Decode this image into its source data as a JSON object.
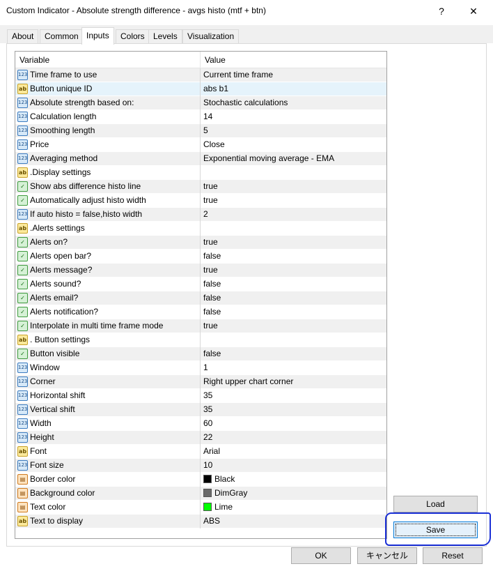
{
  "window": {
    "title": "Custom Indicator - Absolute strength difference - avgs histo (mtf + btn)",
    "help_label": "?",
    "close_label": "✕"
  },
  "tabs": [
    {
      "label": "About"
    },
    {
      "label": "Common"
    },
    {
      "label": "Inputs"
    },
    {
      "label": "Colors"
    },
    {
      "label": "Levels"
    },
    {
      "label": "Visualization"
    }
  ],
  "active_tab": "Inputs",
  "grid": {
    "headers": {
      "variable": "Variable",
      "value": "Value"
    },
    "rows": [
      {
        "icon": "number-type-icon",
        "type": "num",
        "name": "Time frame to use",
        "value": "Current time frame"
      },
      {
        "icon": "string-type-icon",
        "type": "str",
        "name": "Button unique ID",
        "value": "abs b1"
      },
      {
        "icon": "number-type-icon",
        "type": "num",
        "name": "Absolute strength based on:",
        "value": "Stochastic calculations"
      },
      {
        "icon": "number-type-icon",
        "type": "num",
        "name": "Calculation length",
        "value": "14"
      },
      {
        "icon": "number-type-icon",
        "type": "num",
        "name": "Smoothing length",
        "value": "5"
      },
      {
        "icon": "number-type-icon",
        "type": "num",
        "name": "Price",
        "value": "Close"
      },
      {
        "icon": "number-type-icon",
        "type": "num",
        "name": "Averaging method",
        "value": "Exponential moving average - EMA"
      },
      {
        "icon": "string-type-icon",
        "type": "str",
        "name": ".Display settings",
        "value": ""
      },
      {
        "icon": "bool-type-icon",
        "type": "bool",
        "name": "Show abs difference histo line",
        "value": "true"
      },
      {
        "icon": "bool-type-icon",
        "type": "bool",
        "name": "Automatically adjust histo width",
        "value": "true"
      },
      {
        "icon": "number-type-icon",
        "type": "num",
        "name": "If auto histo = false,histo width",
        "value": "2"
      },
      {
        "icon": "string-type-icon",
        "type": "str",
        "name": ".Alerts settings",
        "value": ""
      },
      {
        "icon": "bool-type-icon",
        "type": "bool",
        "name": "Alerts on?",
        "value": "true"
      },
      {
        "icon": "bool-type-icon",
        "type": "bool",
        "name": "Alerts open bar?",
        "value": "false"
      },
      {
        "icon": "bool-type-icon",
        "type": "bool",
        "name": "Alerts message?",
        "value": "true"
      },
      {
        "icon": "bool-type-icon",
        "type": "bool",
        "name": "Alerts sound?",
        "value": "false"
      },
      {
        "icon": "bool-type-icon",
        "type": "bool",
        "name": "Alerts email?",
        "value": "false"
      },
      {
        "icon": "bool-type-icon",
        "type": "bool",
        "name": "Alerts notification?",
        "value": "false"
      },
      {
        "icon": "bool-type-icon",
        "type": "bool",
        "name": "Interpolate in multi time frame mode",
        "value": "true"
      },
      {
        "icon": "string-type-icon",
        "type": "str",
        "name": ". Button settings",
        "value": ""
      },
      {
        "icon": "bool-type-icon",
        "type": "bool",
        "name": "Button visible",
        "value": "false"
      },
      {
        "icon": "number-type-icon",
        "type": "num",
        "name": "Window",
        "value": "1"
      },
      {
        "icon": "number-type-icon",
        "type": "num",
        "name": "Corner",
        "value": "Right upper chart corner"
      },
      {
        "icon": "number-type-icon",
        "type": "num",
        "name": "Horizontal shift",
        "value": "35"
      },
      {
        "icon": "number-type-icon",
        "type": "num",
        "name": "Vertical shift",
        "value": "35"
      },
      {
        "icon": "number-type-icon",
        "type": "num",
        "name": "Width",
        "value": "60"
      },
      {
        "icon": "number-type-icon",
        "type": "num",
        "name": "Height",
        "value": "22"
      },
      {
        "icon": "string-type-icon",
        "type": "str",
        "name": "Font",
        "value": "Arial"
      },
      {
        "icon": "number-type-icon",
        "type": "num",
        "name": "Font size",
        "value": "10"
      },
      {
        "icon": "color-type-icon",
        "type": "color",
        "name": "Border color",
        "value": "Black",
        "swatch": "#000000"
      },
      {
        "icon": "color-type-icon",
        "type": "color",
        "name": "Background color",
        "value": "DimGray",
        "swatch": "#696969"
      },
      {
        "icon": "color-type-icon",
        "type": "color",
        "name": "Text color",
        "value": "Lime",
        "swatch": "#00ff00"
      },
      {
        "icon": "string-type-icon",
        "type": "str",
        "name": "Text to display",
        "value": "ABS"
      }
    ]
  },
  "side_buttons": {
    "load": "Load",
    "save": "Save"
  },
  "footer_buttons": {
    "ok": "OK",
    "cancel": "キャンセル",
    "reset": "Reset"
  },
  "icon_glyphs": {
    "num": "123",
    "str": "ab",
    "bool": "✓",
    "color": "▤"
  }
}
